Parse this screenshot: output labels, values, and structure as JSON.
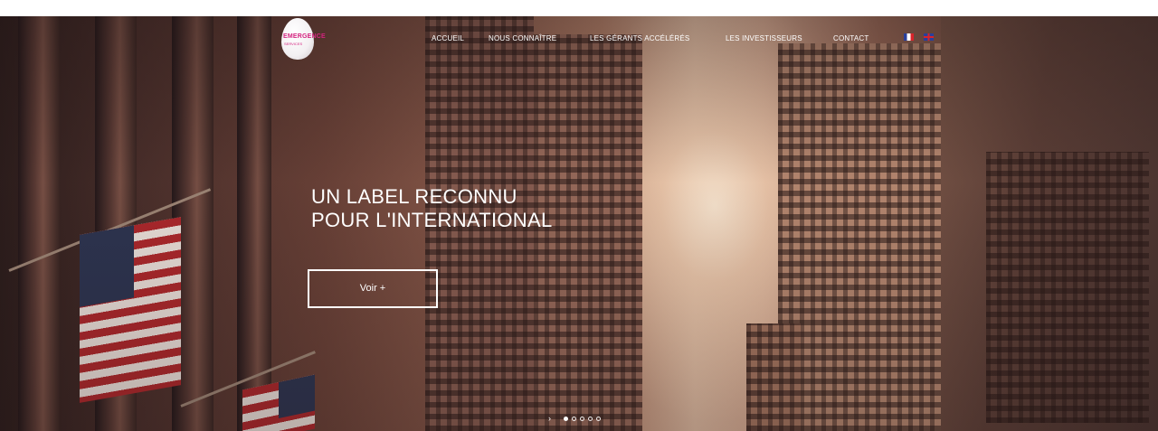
{
  "header": {
    "logo_text": "EMERGENCE",
    "logo_subtext": "SERVICES"
  },
  "nav": {
    "items": [
      "ACCUEIL",
      "NOUS CONNAÎTRE",
      "LES GÉRANTS ACCÉLÉRÉS",
      "LES INVESTISSEURS",
      "CONTACT"
    ],
    "languages": [
      "fr",
      "en"
    ]
  },
  "hero": {
    "headline_line1": "UN LABEL RECONNU",
    "headline_line2": "POUR L'INTERNATIONAL",
    "cta_label": "Voir +",
    "slide_arrow": "›",
    "slides_count": 5,
    "active_slide": 1
  },
  "colors": {
    "brand": "#d4237f",
    "text_on_hero": "#ffffff"
  }
}
